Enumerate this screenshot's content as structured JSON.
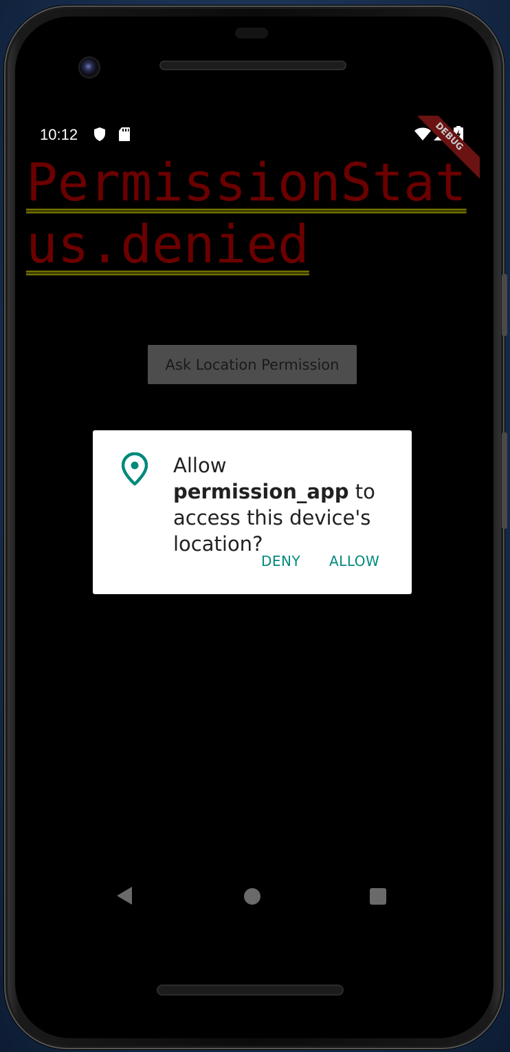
{
  "statusbar": {
    "time": "10:12",
    "icons_left": [
      "shield-icon",
      "sd-card-icon"
    ],
    "icons_right": [
      "wifi-icon",
      "signal-icon",
      "battery-charging-icon"
    ]
  },
  "debug_banner": "DEBUG",
  "permission_status_text": "PermissionStatus.denied",
  "ask_button_label": "Ask Location Permission",
  "dialog": {
    "icon": "location-pin-icon",
    "message_prefix": "Allow ",
    "app_name": "permission_app",
    "message_suffix": " to access this device's location?",
    "deny_label": "DENY",
    "allow_label": "ALLOW"
  },
  "navbar": {
    "back": "back-icon",
    "home": "home-icon",
    "recents": "recents-icon"
  },
  "colors": {
    "status_text": "#6b0000",
    "underline": "#6b6b00",
    "accent": "#00897b",
    "button_bg": "#4d4d4d"
  }
}
